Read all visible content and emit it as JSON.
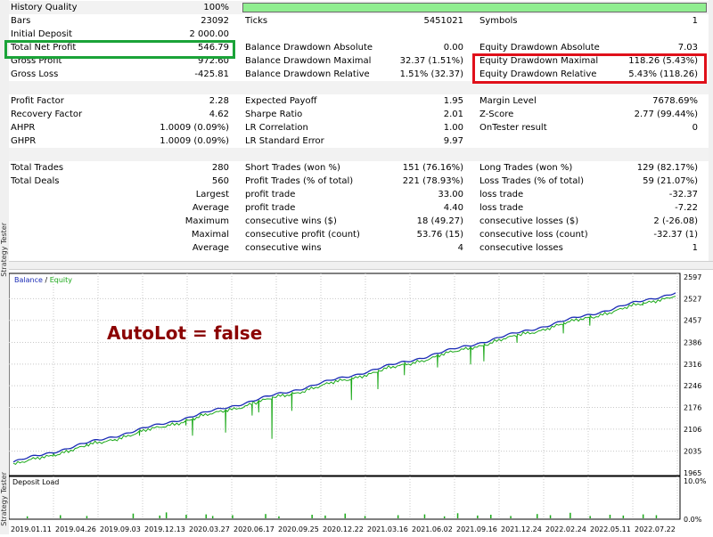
{
  "side_tabs": [
    "Strategy Tester",
    "Strategy Tester"
  ],
  "report": {
    "rows": [
      {
        "shade": true,
        "cells": [
          {
            "text": "History Quality",
            "x": 2,
            "w": 140,
            "align": "left"
          },
          {
            "text": "100%",
            "x": 140,
            "w": 107,
            "align": "right"
          }
        ],
        "bar": true
      },
      {
        "shade": false,
        "cells": [
          {
            "text": "Bars",
            "x": 2,
            "w": 140,
            "align": "left"
          },
          {
            "text": "23092",
            "x": 140,
            "w": 107,
            "align": "right"
          },
          {
            "text": "Ticks",
            "x": 265,
            "w": 140,
            "align": "left"
          },
          {
            "text": "5451021",
            "x": 405,
            "w": 105,
            "align": "right"
          },
          {
            "text": "Symbols",
            "x": 528,
            "w": 140,
            "align": "left"
          },
          {
            "text": "1",
            "x": 668,
            "w": 105,
            "align": "right"
          }
        ]
      },
      {
        "shade": false,
        "cells": [
          {
            "text": "Initial Deposit",
            "x": 2,
            "w": 140,
            "align": "left"
          },
          {
            "text": "2 000.00",
            "x": 140,
            "w": 107,
            "align": "right"
          }
        ]
      },
      {
        "shade": false,
        "cells": [
          {
            "text": "Total Net Profit",
            "x": 2,
            "w": 140,
            "align": "left"
          },
          {
            "text": "546.79",
            "x": 140,
            "w": 107,
            "align": "right"
          },
          {
            "text": "Balance Drawdown Absolute",
            "x": 265,
            "w": 160,
            "align": "left"
          },
          {
            "text": "0.00",
            "x": 405,
            "w": 105,
            "align": "right"
          },
          {
            "text": "Equity Drawdown Absolute",
            "x": 528,
            "w": 160,
            "align": "left"
          },
          {
            "text": "7.03",
            "x": 668,
            "w": 105,
            "align": "right"
          }
        ]
      },
      {
        "shade": false,
        "cells": [
          {
            "text": "Gross Profit",
            "x": 2,
            "w": 140,
            "align": "left"
          },
          {
            "text": "972.60",
            "x": 140,
            "w": 107,
            "align": "right"
          },
          {
            "text": "Balance Drawdown Maximal",
            "x": 265,
            "w": 160,
            "align": "left"
          },
          {
            "text": "32.37 (1.51%)",
            "x": 405,
            "w": 105,
            "align": "right"
          },
          {
            "text": "Equity Drawdown Maximal",
            "x": 528,
            "w": 160,
            "align": "left"
          },
          {
            "text": "118.26 (5.43%)",
            "x": 668,
            "w": 105,
            "align": "right"
          }
        ]
      },
      {
        "shade": false,
        "cells": [
          {
            "text": "Gross Loss",
            "x": 2,
            "w": 140,
            "align": "left"
          },
          {
            "text": "-425.81",
            "x": 140,
            "w": 107,
            "align": "right"
          },
          {
            "text": "Balance Drawdown Relative",
            "x": 265,
            "w": 160,
            "align": "left"
          },
          {
            "text": "1.51% (32.37)",
            "x": 405,
            "w": 105,
            "align": "right"
          },
          {
            "text": "Equity Drawdown Relative",
            "x": 528,
            "w": 160,
            "align": "left"
          },
          {
            "text": "5.43% (118.26)",
            "x": 668,
            "w": 105,
            "align": "right"
          }
        ]
      },
      {
        "shade": true,
        "cells": []
      },
      {
        "shade": false,
        "cells": [
          {
            "text": "Profit Factor",
            "x": 2,
            "w": 140,
            "align": "left"
          },
          {
            "text": "2.28",
            "x": 140,
            "w": 107,
            "align": "right"
          },
          {
            "text": "Expected Payoff",
            "x": 265,
            "w": 140,
            "align": "left"
          },
          {
            "text": "1.95",
            "x": 405,
            "w": 105,
            "align": "right"
          },
          {
            "text": "Margin Level",
            "x": 528,
            "w": 140,
            "align": "left"
          },
          {
            "text": "7678.69%",
            "x": 668,
            "w": 105,
            "align": "right"
          }
        ]
      },
      {
        "shade": false,
        "cells": [
          {
            "text": "Recovery Factor",
            "x": 2,
            "w": 140,
            "align": "left"
          },
          {
            "text": "4.62",
            "x": 140,
            "w": 107,
            "align": "right"
          },
          {
            "text": "Sharpe Ratio",
            "x": 265,
            "w": 140,
            "align": "left"
          },
          {
            "text": "2.01",
            "x": 405,
            "w": 105,
            "align": "right"
          },
          {
            "text": "Z-Score",
            "x": 528,
            "w": 140,
            "align": "left"
          },
          {
            "text": "2.77 (99.44%)",
            "x": 668,
            "w": 105,
            "align": "right"
          }
        ]
      },
      {
        "shade": false,
        "cells": [
          {
            "text": "AHPR",
            "x": 2,
            "w": 140,
            "align": "left"
          },
          {
            "text": "1.0009 (0.09%)",
            "x": 140,
            "w": 107,
            "align": "right"
          },
          {
            "text": "LR Correlation",
            "x": 265,
            "w": 140,
            "align": "left"
          },
          {
            "text": "1.00",
            "x": 405,
            "w": 105,
            "align": "right"
          },
          {
            "text": "OnTester result",
            "x": 528,
            "w": 140,
            "align": "left"
          },
          {
            "text": "0",
            "x": 668,
            "w": 105,
            "align": "right"
          }
        ]
      },
      {
        "shade": false,
        "cells": [
          {
            "text": "GHPR",
            "x": 2,
            "w": 140,
            "align": "left"
          },
          {
            "text": "1.0009 (0.09%)",
            "x": 140,
            "w": 107,
            "align": "right"
          },
          {
            "text": "LR Standard Error",
            "x": 265,
            "w": 140,
            "align": "left"
          },
          {
            "text": "9.97",
            "x": 405,
            "w": 105,
            "align": "right"
          }
        ]
      },
      {
        "shade": true,
        "cells": []
      },
      {
        "shade": false,
        "cells": [
          {
            "text": "Total Trades",
            "x": 2,
            "w": 140,
            "align": "left"
          },
          {
            "text": "280",
            "x": 140,
            "w": 107,
            "align": "right"
          },
          {
            "text": "Short Trades (won %)",
            "x": 265,
            "w": 140,
            "align": "left"
          },
          {
            "text": "151 (76.16%)",
            "x": 405,
            "w": 105,
            "align": "right"
          },
          {
            "text": "Long Trades (won %)",
            "x": 528,
            "w": 140,
            "align": "left"
          },
          {
            "text": "129 (82.17%)",
            "x": 668,
            "w": 105,
            "align": "right"
          }
        ]
      },
      {
        "shade": false,
        "cells": [
          {
            "text": "Total Deals",
            "x": 2,
            "w": 140,
            "align": "left"
          },
          {
            "text": "560",
            "x": 140,
            "w": 107,
            "align": "right"
          },
          {
            "text": "Profit Trades (% of total)",
            "x": 265,
            "w": 140,
            "align": "left"
          },
          {
            "text": "221 (78.93%)",
            "x": 405,
            "w": 105,
            "align": "right"
          },
          {
            "text": "Loss Trades (% of total)",
            "x": 528,
            "w": 140,
            "align": "left"
          },
          {
            "text": "59 (21.07%)",
            "x": 668,
            "w": 105,
            "align": "right"
          }
        ]
      },
      {
        "shade": false,
        "cells": [
          {
            "text": "Largest",
            "x": 140,
            "w": 107,
            "align": "right"
          },
          {
            "text": "profit trade",
            "x": 265,
            "w": 140,
            "align": "left"
          },
          {
            "text": "33.00",
            "x": 405,
            "w": 105,
            "align": "right"
          },
          {
            "text": "loss trade",
            "x": 528,
            "w": 140,
            "align": "left"
          },
          {
            "text": "-32.37",
            "x": 668,
            "w": 105,
            "align": "right"
          }
        ]
      },
      {
        "shade": false,
        "cells": [
          {
            "text": "Average",
            "x": 140,
            "w": 107,
            "align": "right"
          },
          {
            "text": "profit trade",
            "x": 265,
            "w": 140,
            "align": "left"
          },
          {
            "text": "4.40",
            "x": 405,
            "w": 105,
            "align": "right"
          },
          {
            "text": "loss trade",
            "x": 528,
            "w": 140,
            "align": "left"
          },
          {
            "text": "-7.22",
            "x": 668,
            "w": 105,
            "align": "right"
          }
        ]
      },
      {
        "shade": false,
        "cells": [
          {
            "text": "Maximum",
            "x": 140,
            "w": 107,
            "align": "right"
          },
          {
            "text": "consecutive wins ($)",
            "x": 265,
            "w": 140,
            "align": "left"
          },
          {
            "text": "18 (49.27)",
            "x": 405,
            "w": 105,
            "align": "right"
          },
          {
            "text": "consecutive losses ($)",
            "x": 528,
            "w": 140,
            "align": "left"
          },
          {
            "text": "2 (-26.08)",
            "x": 668,
            "w": 105,
            "align": "right"
          }
        ]
      },
      {
        "shade": false,
        "cells": [
          {
            "text": "Maximal",
            "x": 140,
            "w": 107,
            "align": "right"
          },
          {
            "text": "consecutive profit (count)",
            "x": 265,
            "w": 140,
            "align": "left"
          },
          {
            "text": "53.76 (15)",
            "x": 405,
            "w": 105,
            "align": "right"
          },
          {
            "text": "consecutive loss (count)",
            "x": 528,
            "w": 140,
            "align": "left"
          },
          {
            "text": "-32.37 (1)",
            "x": 668,
            "w": 105,
            "align": "right"
          }
        ]
      },
      {
        "shade": false,
        "cells": [
          {
            "text": "Average",
            "x": 140,
            "w": 107,
            "align": "right"
          },
          {
            "text": "consecutive wins",
            "x": 265,
            "w": 140,
            "align": "left"
          },
          {
            "text": "4",
            "x": 405,
            "w": 105,
            "align": "right"
          },
          {
            "text": "consecutive losses",
            "x": 528,
            "w": 140,
            "align": "left"
          },
          {
            "text": "1",
            "x": 668,
            "w": 105,
            "align": "right"
          }
        ]
      }
    ]
  },
  "chart_data": {
    "type": "line",
    "legend": [
      "Balance",
      "Equity"
    ],
    "annotation": "AutoLot = false",
    "y_ticks": [
      "2597",
      "2527",
      "2457",
      "2386",
      "2316",
      "2246",
      "2176",
      "2106",
      "2035",
      "1965"
    ],
    "ylim": [
      1965,
      2597
    ],
    "x_ticks": [
      "2019.01.11",
      "2019.04.26",
      "2019.09.03",
      "2019.12.13",
      "2020.03.27",
      "2020.06.17",
      "2020.09.25",
      "2020.12.22",
      "2021.03.16",
      "2021.06.02",
      "2021.09.16",
      "2021.12.24",
      "2022.02.24",
      "2022.05.11",
      "2022.07.22"
    ],
    "series": [
      {
        "name": "Balance",
        "start": 2000,
        "end": 2546.79
      },
      {
        "name": "Equity",
        "dips": [
          {
            "t": 0.06,
            "v": 2030
          },
          {
            "t": 0.11,
            "v": 2060
          },
          {
            "t": 0.19,
            "v": 2085
          },
          {
            "t": 0.26,
            "v": 2118
          },
          {
            "t": 0.27,
            "v": 2085
          },
          {
            "t": 0.32,
            "v": 2095
          },
          {
            "t": 0.36,
            "v": 2150
          },
          {
            "t": 0.37,
            "v": 2160
          },
          {
            "t": 0.39,
            "v": 2075
          },
          {
            "t": 0.42,
            "v": 2165
          },
          {
            "t": 0.51,
            "v": 2200
          },
          {
            "t": 0.55,
            "v": 2235
          },
          {
            "t": 0.59,
            "v": 2280
          },
          {
            "t": 0.64,
            "v": 2305
          },
          {
            "t": 0.69,
            "v": 2315
          },
          {
            "t": 0.71,
            "v": 2325
          },
          {
            "t": 0.76,
            "v": 2385
          },
          {
            "t": 0.83,
            "v": 2415
          },
          {
            "t": 0.87,
            "v": 2440
          },
          {
            "t": 0.95,
            "v": 2505
          }
        ]
      }
    ]
  },
  "deposit_load": {
    "title": "Deposit Load",
    "y_ticks": [
      "10.0%",
      "0.0%"
    ],
    "bars": [
      0.02,
      0.07,
      0.11,
      0.18,
      0.22,
      0.23,
      0.26,
      0.29,
      0.3,
      0.33,
      0.38,
      0.4,
      0.45,
      0.47,
      0.5,
      0.53,
      0.58,
      0.62,
      0.65,
      0.67,
      0.7,
      0.72,
      0.75,
      0.79,
      0.81,
      0.84,
      0.87,
      0.9,
      0.92,
      0.95,
      0.97
    ],
    "bar_heights_pct": [
      0.5,
      0.8,
      0.6,
      1.2,
      0.7,
      1.5,
      0.9,
      1.0,
      0.6,
      0.8,
      1.1,
      0.5,
      0.9,
      0.7,
      1.2,
      0.6,
      0.8,
      1.0,
      0.5,
      1.3,
      0.7,
      0.9,
      0.6,
      1.1,
      0.8,
      1.4,
      0.6,
      0.9,
      0.7,
      1.0,
      0.8
    ]
  },
  "colors": {
    "balance": "#1a2bb5",
    "equity": "#1aa818",
    "annotation": "#8b0000",
    "quality_bar": "#90ee90",
    "highlight_green": "#1aa338",
    "highlight_red": "#e0101a",
    "deposit": "#1aa818"
  }
}
